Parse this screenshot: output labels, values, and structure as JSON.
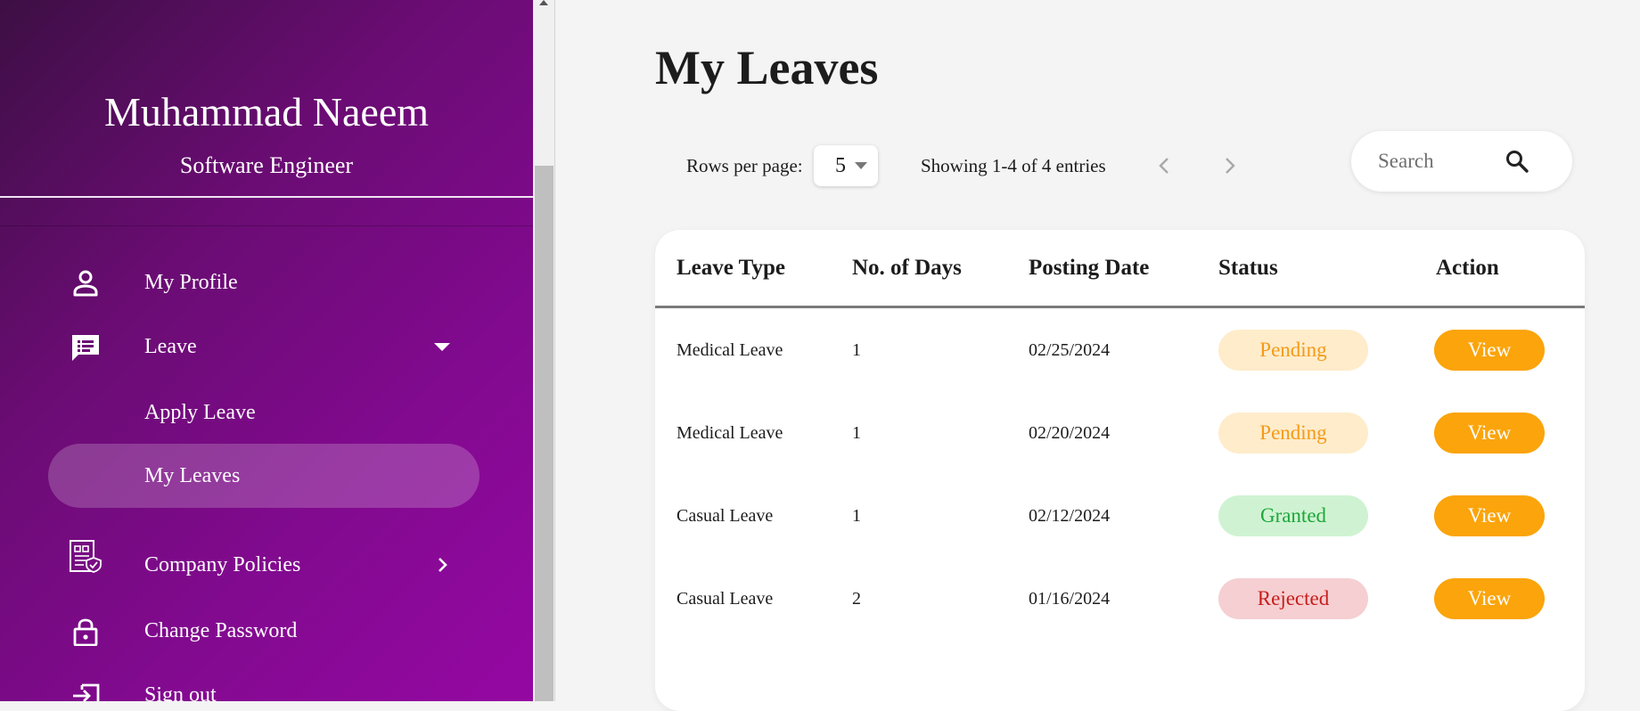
{
  "user": {
    "name": "Muhammad Naeem",
    "role": "Software Engineer"
  },
  "nav": {
    "my_profile": "My Profile",
    "leave": "Leave",
    "apply_leave": "Apply Leave",
    "my_leaves": "My Leaves",
    "company_policies": "Company Policies",
    "change_password": "Change Password",
    "sign_out": "Sign out"
  },
  "icons": {
    "my_profile": "person-icon",
    "leave": "chat-list-icon",
    "company_policies": "policy-document-icon",
    "change_password": "lock-icon",
    "sign_out": "sign-out-icon",
    "search": "search-icon"
  },
  "page": {
    "title": "My Leaves"
  },
  "pagination": {
    "rows_label": "Rows per page:",
    "rows_value": "5",
    "showing": "Showing 1-4 of 4 entries"
  },
  "search": {
    "placeholder": "Search"
  },
  "table": {
    "headers": [
      "Leave Type",
      "No. of Days",
      "Posting Date",
      "Status",
      "Action"
    ],
    "rows": [
      {
        "type": "Medical Leave",
        "days": "1",
        "date": "02/25/2024",
        "status": "Pending",
        "action": "View"
      },
      {
        "type": "Medical Leave",
        "days": "1",
        "date": "02/20/2024",
        "status": "Pending",
        "action": "View"
      },
      {
        "type": "Casual Leave",
        "days": "1",
        "date": "02/12/2024",
        "status": "Granted",
        "action": "View"
      },
      {
        "type": "Casual Leave",
        "days": "2",
        "date": "01/16/2024",
        "status": "Rejected",
        "action": "View"
      }
    ]
  },
  "colors": {
    "sidebar_start": "#3d0f44",
    "sidebar_end": "#9508a3",
    "view_button": "#fba40b",
    "pending_bg": "#ffeccb",
    "pending_text": "#f49a18",
    "granted_bg": "#cff3d2",
    "granted_text": "#1fa63a",
    "rejected_bg": "#f5cfd1",
    "rejected_text": "#c81c1c"
  }
}
